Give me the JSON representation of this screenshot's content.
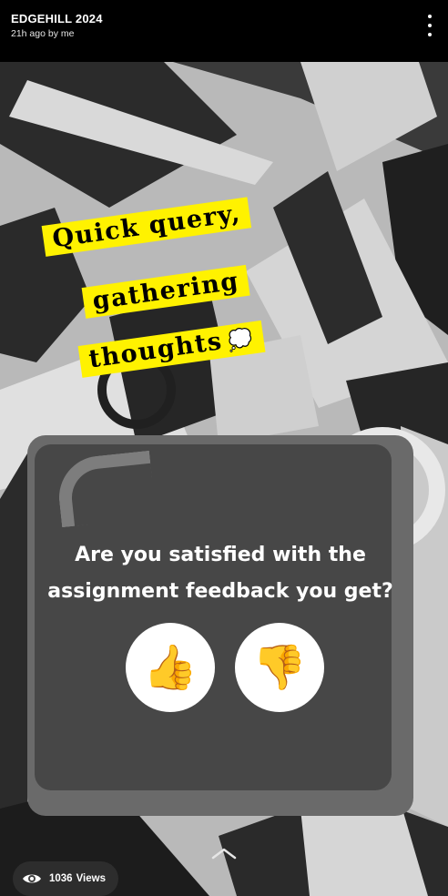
{
  "header": {
    "title": "EDGEHILL 2024",
    "subtitle": "21h ago by me"
  },
  "caption": {
    "line1": "Quick query,",
    "line2": "gathering",
    "line3": "thoughts",
    "emoji": "💭"
  },
  "poll": {
    "question": "Are you satisfied with the assignment feedback you get?",
    "options": [
      {
        "emoji": "👍",
        "icon": "thumbs-up-icon"
      },
      {
        "emoji": "👎",
        "icon": "thumbs-down-icon"
      }
    ]
  },
  "footer": {
    "views_count": "1036",
    "views_label": "Views"
  },
  "colors": {
    "caption_bg": "#fff200",
    "poll_bg": "#474747",
    "thumb": "#f4b400"
  }
}
